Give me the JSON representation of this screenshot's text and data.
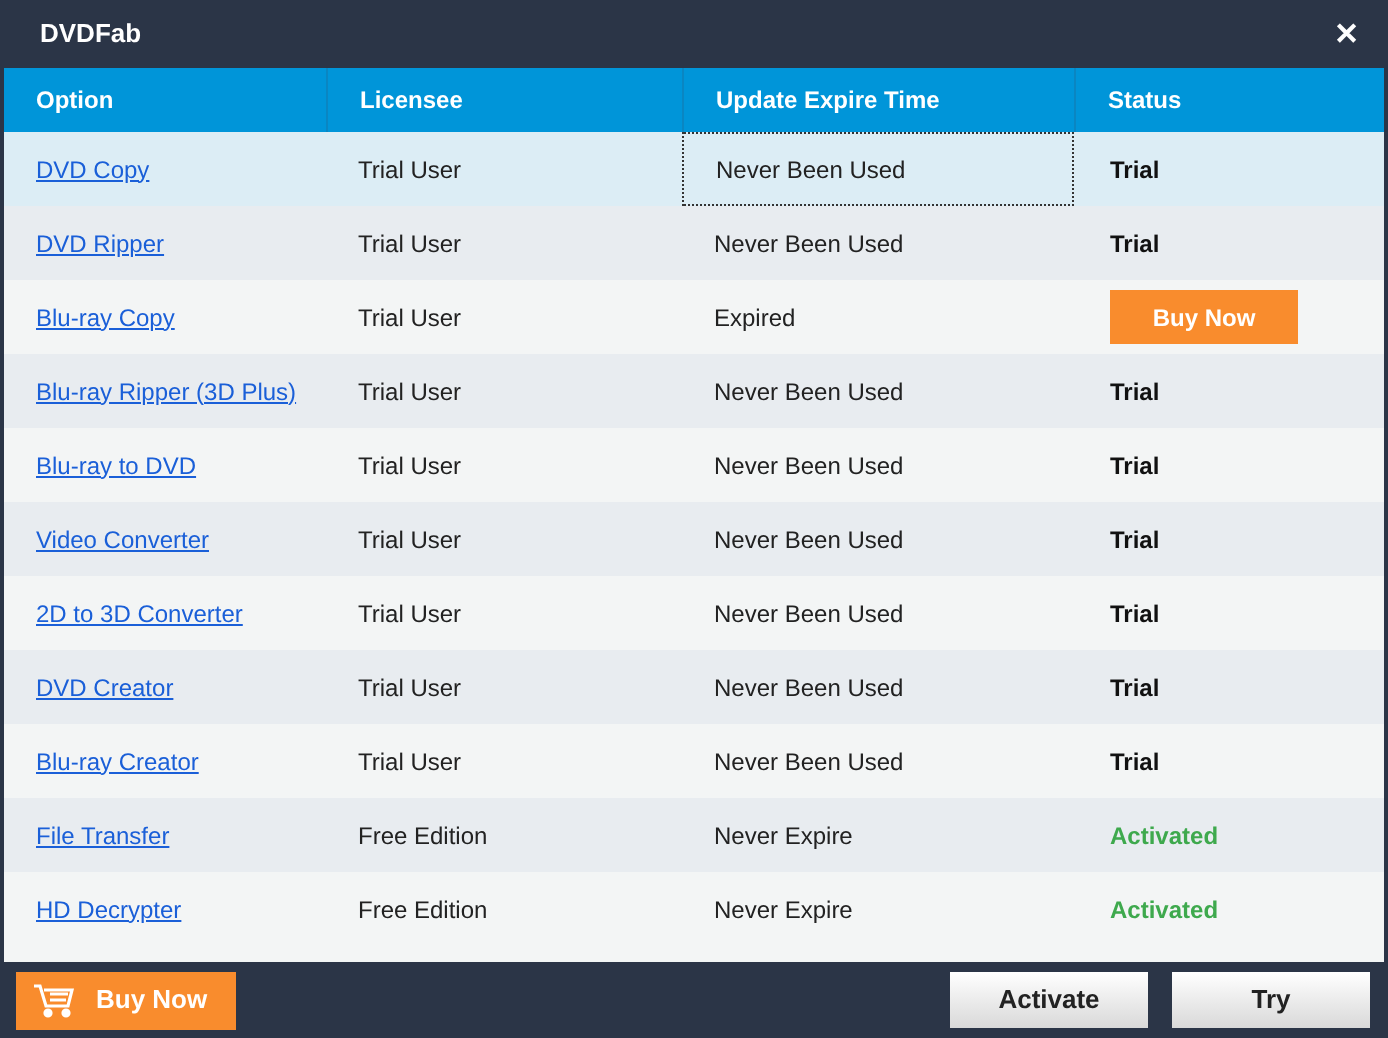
{
  "window": {
    "title": "DVDFab",
    "close": "✕"
  },
  "table": {
    "columns": [
      "Option",
      "Licensee",
      "Update Expire Time",
      "Status"
    ],
    "rows": [
      {
        "option": "DVD Copy",
        "licensee": "Trial User",
        "expire": "Never Been Used",
        "status": {
          "kind": "text",
          "text": "Trial"
        },
        "selected": true
      },
      {
        "option": "DVD Ripper",
        "licensee": "Trial User",
        "expire": "Never Been Used",
        "status": {
          "kind": "text",
          "text": "Trial"
        },
        "selected": false
      },
      {
        "option": "Blu-ray Copy",
        "licensee": "Trial User",
        "expire": "Expired",
        "status": {
          "kind": "button",
          "text": "Buy Now"
        },
        "selected": false
      },
      {
        "option": "Blu-ray Ripper (3D Plus)",
        "licensee": "Trial User",
        "expire": "Never Been Used",
        "status": {
          "kind": "text",
          "text": "Trial"
        },
        "selected": false
      },
      {
        "option": "Blu-ray to DVD",
        "licensee": "Trial User",
        "expire": "Never Been Used",
        "status": {
          "kind": "text",
          "text": "Trial"
        },
        "selected": false
      },
      {
        "option": "Video Converter",
        "licensee": "Trial User",
        "expire": "Never Been Used",
        "status": {
          "kind": "text",
          "text": "Trial"
        },
        "selected": false
      },
      {
        "option": "2D to 3D Converter",
        "licensee": "Trial User",
        "expire": "Never Been Used",
        "status": {
          "kind": "text",
          "text": "Trial"
        },
        "selected": false
      },
      {
        "option": "DVD Creator",
        "licensee": "Trial User",
        "expire": "Never Been Used",
        "status": {
          "kind": "text",
          "text": "Trial"
        },
        "selected": false
      },
      {
        "option": "Blu-ray Creator",
        "licensee": "Trial User",
        "expire": "Never Been Used",
        "status": {
          "kind": "text",
          "text": "Trial"
        },
        "selected": false
      },
      {
        "option": "File Transfer",
        "licensee": "Free Edition",
        "expire": "Never Expire",
        "status": {
          "kind": "active",
          "text": "Activated"
        },
        "selected": false
      },
      {
        "option": "HD Decrypter",
        "licensee": "Free Edition",
        "expire": "Never Expire",
        "status": {
          "kind": "active",
          "text": "Activated"
        },
        "selected": false
      }
    ]
  },
  "footer": {
    "buy": "Buy Now",
    "activate": "Activate",
    "try": "Try"
  }
}
